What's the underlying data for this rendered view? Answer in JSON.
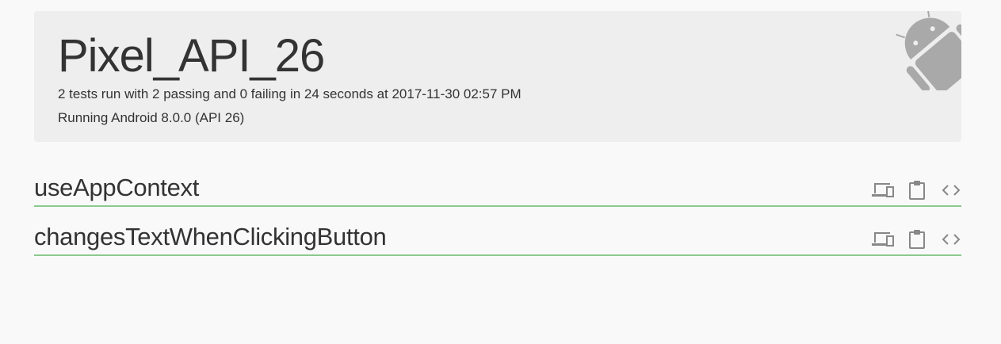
{
  "header": {
    "device_name": "Pixel_API_26",
    "summary": "2 tests run with 2 passing and 0 failing in 24 seconds at 2017-11-30 02:57 PM",
    "os_line": "Running Android 8.0.0 (API 26)",
    "logo_icon": "android-robot-icon"
  },
  "tests": [
    {
      "name": "useAppContext",
      "status": "passing",
      "status_color": "#8bc98f",
      "actions": [
        "devices-icon",
        "clipboard-icon",
        "code-icon"
      ]
    },
    {
      "name": "changesTextWhenClickingButton",
      "status": "passing",
      "status_color": "#8bc98f",
      "actions": [
        "devices-icon",
        "clipboard-icon",
        "code-icon"
      ]
    }
  ],
  "colors": {
    "background": "#f9f9f9",
    "header_background": "#eeeeee",
    "passing": "#8bc98f",
    "icon": "#888888"
  }
}
